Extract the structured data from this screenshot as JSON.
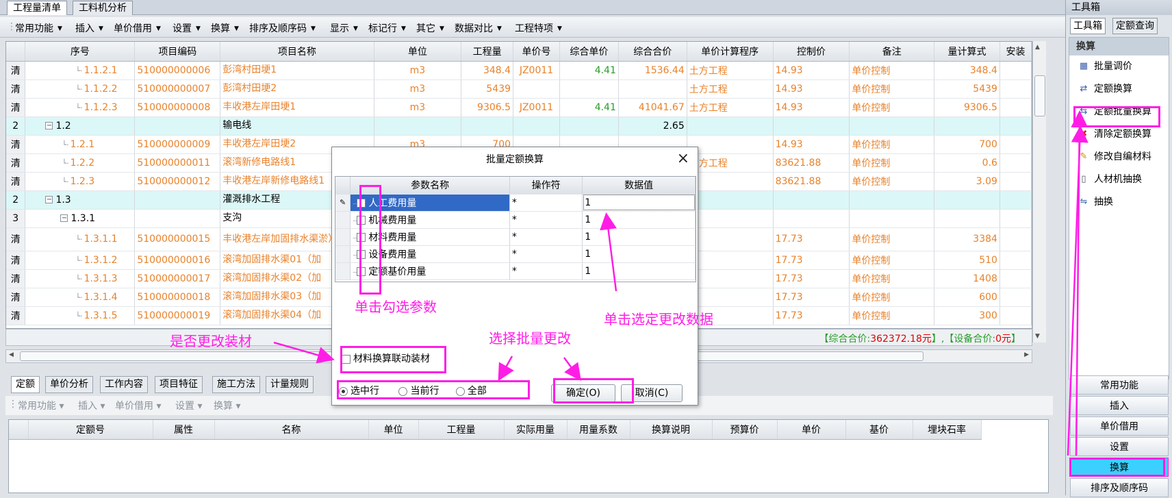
{
  "top_tabs": [
    "工程量清单",
    "工料机分析"
  ],
  "toolbar": [
    "常用功能",
    "插入",
    "单价借用",
    "设置",
    "换算",
    "排序及顺序码",
    "显示",
    "标记行",
    "其它",
    "数据对比",
    "工程特项"
  ],
  "grid": {
    "headers": [
      "序号",
      "项目编码",
      "项目名称",
      "单位",
      "工程量",
      "单价号",
      "综合单价",
      "综合合价",
      "单价计算程序",
      "控制价",
      "备注",
      "量计算式",
      "安装"
    ],
    "rows": [
      {
        "type": "清",
        "no": "1.1.2.1",
        "code": "510000000006",
        "name": "彭湾村田埂1",
        "unit": "m3",
        "qty": "348.4",
        "pno": "JZ0011",
        "price": "4.41",
        "total": "1536.44",
        "prog": "土方工程",
        "ctrl": "14.93",
        "remark": "单价控制",
        "formula": "348.4"
      },
      {
        "type": "清",
        "no": "1.1.2.2",
        "code": "510000000007",
        "name": "彭湾村田埂2",
        "unit": "m3",
        "qty": "5439",
        "pno": "",
        "price": "",
        "total": "",
        "prog": "土方工程",
        "ctrl": "14.93",
        "remark": "单价控制",
        "formula": "5439"
      },
      {
        "type": "清",
        "no": "1.1.2.3",
        "code": "510000000008",
        "name": "丰收港左岸田埂1",
        "unit": "m3",
        "qty": "9306.5",
        "pno": "JZ0011",
        "price": "4.41",
        "total": "41041.67",
        "prog": "土方工程",
        "ctrl": "14.93",
        "remark": "单价控制",
        "formula": "9306.5"
      },
      {
        "type": "2",
        "no": "1.2",
        "code": "",
        "name": "输电线",
        "unit": "",
        "qty": "",
        "pno": "",
        "price": "",
        "total": "2.65",
        "prog": "",
        "ctrl": "",
        "remark": "",
        "formula": ""
      },
      {
        "type": "清",
        "no": "1.2.1",
        "code": "510000000009",
        "name": "丰收港左岸田埂2",
        "unit": "m3",
        "qty": "700",
        "pno": "",
        "price": "",
        "total": "",
        "prog": "",
        "ctrl": "14.93",
        "remark": "单价控制",
        "formula": "700"
      },
      {
        "type": "清",
        "no": "1.2.2",
        "code": "510000000011",
        "name": "滚湾新修电路线1",
        "unit": "",
        "qty": "",
        "pno": "",
        "price": "",
        "total": "",
        "prog": "土方工程",
        "ctrl": "83621.88",
        "remark": "单价控制",
        "formula": "0.6"
      },
      {
        "type": "清",
        "no": "1.2.3",
        "code": "510000000012",
        "name": "丰收港左岸新修电路线1",
        "unit": "",
        "qty": "",
        "pno": "",
        "price": "",
        "total": "",
        "prog": "",
        "ctrl": "83621.88",
        "remark": "单价控制",
        "formula": "3.09"
      },
      {
        "type": "2",
        "no": "1.3",
        "code": "",
        "name": "灌溉排水工程",
        "unit": "",
        "qty": "",
        "pno": "",
        "price": "",
        "total": "",
        "prog": "",
        "ctrl": "",
        "remark": "",
        "formula": ""
      },
      {
        "type": "3",
        "no": "1.3.1",
        "code": "",
        "name": "支沟",
        "unit": "",
        "qty": "",
        "pno": "",
        "price": "",
        "total": "",
        "prog": "",
        "ctrl": "",
        "remark": "",
        "formula": ""
      },
      {
        "type": "清",
        "no": "1.3.1.1",
        "code": "510000000015",
        "name": "丰收港左岸加固排水渠淤）",
        "unit": "",
        "qty": "",
        "pno": "",
        "price": "",
        "total": "",
        "prog": "",
        "ctrl": "17.73",
        "remark": "单价控制",
        "formula": "3384"
      },
      {
        "type": "清",
        "no": "1.3.1.2",
        "code": "510000000016",
        "name": "滚湾加固排水渠01（加",
        "unit": "",
        "qty": "",
        "pno": "",
        "price": "",
        "total": "",
        "prog": "",
        "ctrl": "17.73",
        "remark": "单价控制",
        "formula": "510"
      },
      {
        "type": "清",
        "no": "1.3.1.3",
        "code": "510000000017",
        "name": "滚湾加固排水渠02（加",
        "unit": "",
        "qty": "",
        "pno": "",
        "price": "",
        "total": "",
        "prog": "",
        "ctrl": "17.73",
        "remark": "单价控制",
        "formula": "1408"
      },
      {
        "type": "清",
        "no": "1.3.1.4",
        "code": "510000000018",
        "name": "滚湾加固排水渠03（加",
        "unit": "",
        "qty": "",
        "pno": "",
        "price": "",
        "total": "",
        "prog": "",
        "ctrl": "17.73",
        "remark": "单价控制",
        "formula": "600"
      },
      {
        "type": "清",
        "no": "1.3.1.5",
        "code": "510000000019",
        "name": "滚湾加固排水渠04（加",
        "unit": "",
        "qty": "",
        "pno": "",
        "price": "",
        "total": "",
        "prog": "",
        "ctrl": "17.73",
        "remark": "单价控制",
        "formula": "300"
      }
    ]
  },
  "status": {
    "total_label": "【综合合价:",
    "total_value": "362372.18元",
    "mid": "】,【设备合价:",
    "equip_value": "0元",
    "end": "】"
  },
  "bottom_tabs": [
    "定额",
    "单价分析",
    "工作内容",
    "项目特征",
    "施工方法",
    "计量规则"
  ],
  "bottom_toolbar": [
    "常用功能",
    "插入",
    "单价借用",
    "设置",
    "换算"
  ],
  "bottom_grid_headers": [
    "定额号",
    "属性",
    "名称",
    "单位",
    "工程量",
    "实际用量",
    "用量系数",
    "换算说明",
    "预算价",
    "单价",
    "基价",
    "埋块石率"
  ],
  "right_panel": {
    "title": "工具箱",
    "tabs": [
      "工具箱",
      "定额查询"
    ],
    "section": "换算",
    "items": [
      {
        "label": "批量调价",
        "icon": "calculator-icon"
      },
      {
        "label": "定额换算",
        "icon": "swap-icon"
      },
      {
        "label": "定额批量换算",
        "icon": "batch-swap-icon"
      },
      {
        "label": "清除定额换算",
        "icon": "clear-icon"
      },
      {
        "label": "修改自编材料",
        "icon": "pencil-icon"
      },
      {
        "label": "人材机抽换",
        "icon": "document-icon"
      },
      {
        "label": "抽换",
        "icon": "replace-icon"
      }
    ],
    "buttons": [
      "常用功能",
      "插入",
      "单价借用",
      "设置",
      "换算",
      "排序及顺序码"
    ]
  },
  "dialog": {
    "title": "批量定额换算",
    "headers": [
      "参数名称",
      "操作符",
      "数据值"
    ],
    "rows": [
      {
        "name": "人工费用量",
        "op": "*",
        "val": "1"
      },
      {
        "name": "机械费用量",
        "op": "*",
        "val": "1"
      },
      {
        "name": "材料费用量",
        "op": "*",
        "val": "1"
      },
      {
        "name": "设备费用量",
        "op": "*",
        "val": "1"
      },
      {
        "name": "定额基价用量",
        "op": "*",
        "val": "1"
      }
    ],
    "checkbox_label": "材料换算联动装材",
    "radios": [
      "选中行",
      "当前行",
      "全部"
    ],
    "ok": "确定(O)",
    "cancel": "取消(C)"
  },
  "annotations": {
    "check_params": "单击勾选参数",
    "select_data": "单击选定更改数据",
    "batch_change": "选择批量更改",
    "change_material": "是否更改装材"
  }
}
